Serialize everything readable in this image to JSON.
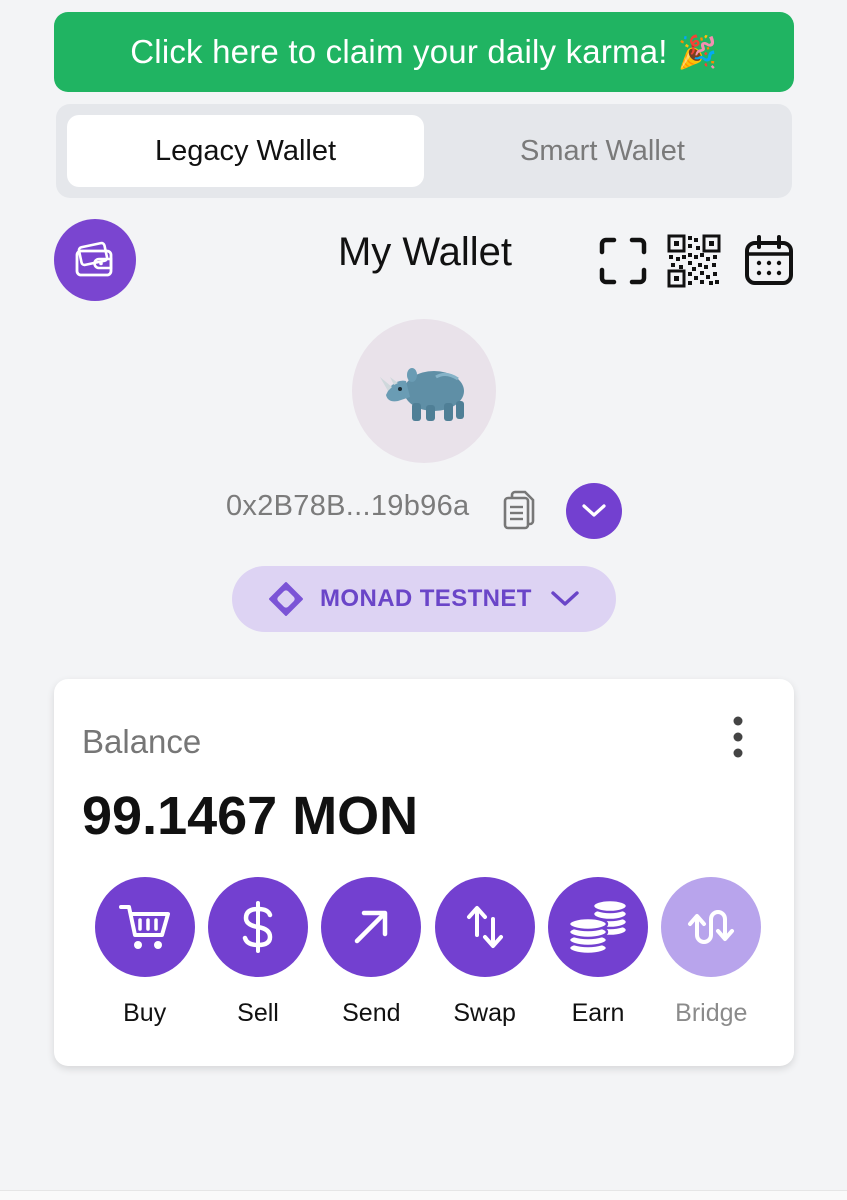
{
  "banner": {
    "text": "Click here to claim your daily karma!",
    "emoji": "🎉"
  },
  "tabs": [
    {
      "label": "Legacy Wallet",
      "active": true
    },
    {
      "label": "Smart Wallet",
      "active": false
    }
  ],
  "header": {
    "title": "My Wallet",
    "icons": [
      "wallet-icon",
      "scan-icon",
      "qr-code-icon",
      "calendar-icon"
    ]
  },
  "avatar": {
    "emoji": "🦏"
  },
  "address": {
    "text": "0x2B78B...19b96a"
  },
  "network": {
    "label": "MONAD TESTNET"
  },
  "balance": {
    "label": "Balance",
    "amount": "99.1467 MON"
  },
  "actions": [
    {
      "label": "Buy",
      "icon": "cart-icon",
      "enabled": true
    },
    {
      "label": "Sell",
      "icon": "dollar-icon",
      "enabled": true
    },
    {
      "label": "Send",
      "icon": "arrow-up-right-icon",
      "enabled": true
    },
    {
      "label": "Swap",
      "icon": "swap-icon",
      "enabled": true
    },
    {
      "label": "Earn",
      "icon": "coins-icon",
      "enabled": true
    },
    {
      "label": "Bridge",
      "icon": "bridge-icon",
      "enabled": false
    }
  ],
  "colors": {
    "accent": "#7340d0",
    "banner_green": "#20b462",
    "network_pill": "#ddd3f3",
    "disabled_action": "#b8a4ec"
  }
}
